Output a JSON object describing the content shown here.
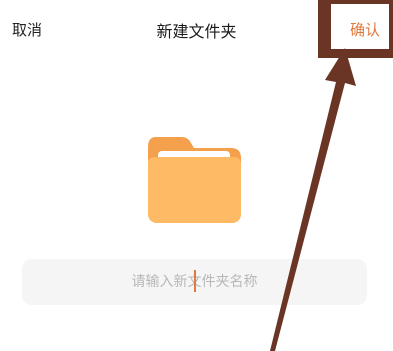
{
  "nav": {
    "cancel_label": "取消",
    "title": "新建文件夹",
    "confirm_label": "确认"
  },
  "input": {
    "placeholder": "请输入新文件夹名称",
    "value": ""
  },
  "icons": {
    "folder": "folder-icon",
    "annotation": "arrow-annotation-icon"
  },
  "colors": {
    "accent": "#e07a3c",
    "folder_back": "#f6a04a",
    "folder_front": "#ffbf6b",
    "annotation": "#6b3526"
  }
}
